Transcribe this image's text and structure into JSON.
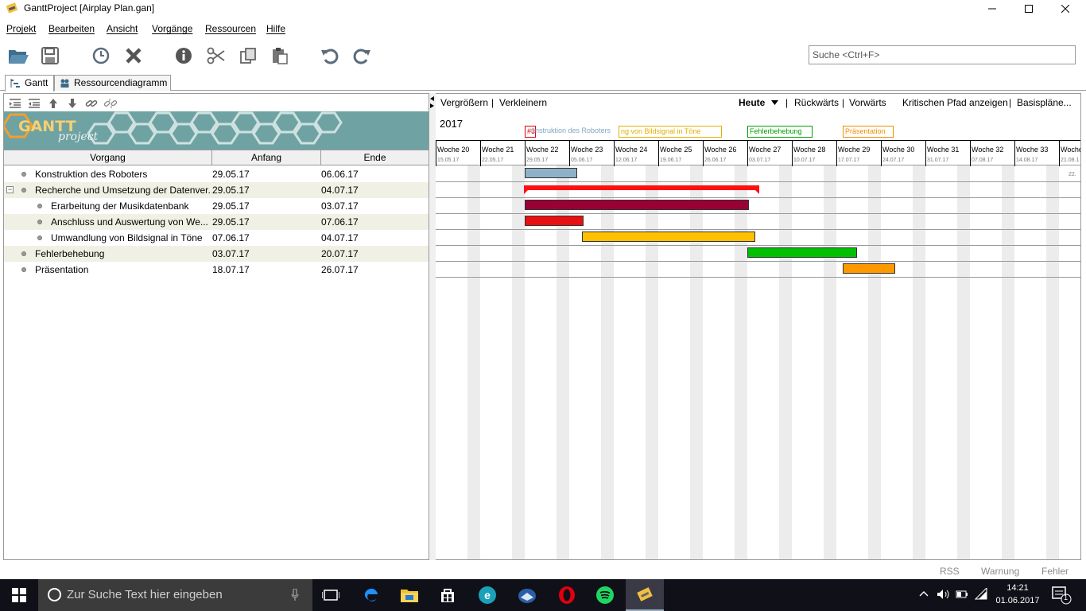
{
  "window": {
    "title": "GanttProject [Airplay Plan.gan]",
    "minimize_icon": "minimize-icon",
    "maximize_icon": "maximize-icon",
    "close_icon": "close-icon"
  },
  "menu": {
    "items": [
      "Projekt",
      "Bearbeiten",
      "Ansicht",
      "Vorgänge",
      "Ressourcen",
      "Hilfe"
    ]
  },
  "toolbar": {
    "icons": [
      "open-folder-icon",
      "save-icon",
      "history-icon",
      "delete-icon",
      "info-icon",
      "cut-icon",
      "copy-icon",
      "paste-icon",
      "undo-icon",
      "redo-icon"
    ],
    "search_placeholder": "Suche <Ctrl+F>"
  },
  "tabs": [
    {
      "label": "Gantt",
      "icon": "gantt-icon",
      "active": true
    },
    {
      "label": "Ressourcendiagramm",
      "icon": "resources-icon",
      "active": false
    }
  ],
  "task_table": {
    "tool_icons": [
      "outdent-icon",
      "indent-icon",
      "move-up-icon",
      "move-down-icon",
      "link-icon",
      "unlink-icon"
    ],
    "logo_text_1": "GANTT",
    "logo_text_2": "project",
    "columns": [
      "Vorgang",
      "Anfang",
      "Ende"
    ],
    "rows": [
      {
        "name": "Konstruktion des Roboters",
        "start": "29.05.17",
        "end": "06.06.17",
        "level": 0,
        "collapse": ""
      },
      {
        "name": "Recherche und Umsetzung der Datenver...",
        "start": "29.05.17",
        "end": "04.07.17",
        "level": 0,
        "collapse": "−"
      },
      {
        "name": "Erarbeitung der Musikdatenbank",
        "start": "29.05.17",
        "end": "03.07.17",
        "level": 1,
        "collapse": ""
      },
      {
        "name": "Anschluss und Auswertung von We...",
        "start": "29.05.17",
        "end": "07.06.17",
        "level": 1,
        "collapse": ""
      },
      {
        "name": "Umwandlung von Bildsignal in Töne",
        "start": "07.06.17",
        "end": "04.07.17",
        "level": 1,
        "collapse": ""
      },
      {
        "name": "Fehlerbehebung",
        "start": "03.07.17",
        "end": "20.07.17",
        "level": 0,
        "collapse": ""
      },
      {
        "name": "Präsentation",
        "start": "18.07.17",
        "end": "26.07.17",
        "level": 0,
        "collapse": ""
      }
    ]
  },
  "chart": {
    "zoom_in": "Vergrößern",
    "separator": "|",
    "zoom_out": "Verkleinern",
    "today": "Heute",
    "back": "Rückwärts",
    "forward": "Vorwärts",
    "critical_path": "Kritischen Pfad anzeigen",
    "baselines": "Basispläne...",
    "year": "2017",
    "weeks": [
      {
        "label": "Woche 20",
        "date": "15.05.17"
      },
      {
        "label": "Woche 21",
        "date": "22.05.17"
      },
      {
        "label": "Woche 22",
        "date": "29.05.17"
      },
      {
        "label": "Woche 23",
        "date": "05.06.17"
      },
      {
        "label": "Woche 24",
        "date": "12.06.17"
      },
      {
        "label": "Woche 25",
        "date": "19.06.17"
      },
      {
        "label": "Woche 26",
        "date": "26.06.17"
      },
      {
        "label": "Woche 27",
        "date": "03.07.17"
      },
      {
        "label": "Woche 28",
        "date": "10.07.17"
      },
      {
        "label": "Woche 29",
        "date": "17.07.17"
      },
      {
        "label": "Woche 30",
        "date": "24.07.17"
      },
      {
        "label": "Woche 31",
        "date": "31.07.17"
      },
      {
        "label": "Woche 32",
        "date": "07.08.17"
      },
      {
        "label": "Woche 33",
        "date": "14.08.17"
      },
      {
        "label": "Woche",
        "date": "21.08.1"
      }
    ],
    "top_labels": [
      {
        "text": "#3",
        "color": "#dd0000"
      },
      {
        "text": "onstruktion des Roboters",
        "color": "#7fa7c0"
      },
      {
        "text": "ng von Bildsignal in Töne",
        "color": "#e0b000"
      },
      {
        "text": "Fehlerbehebung",
        "color": "#00a000"
      },
      {
        "text": "Präsentation",
        "color": "#f08c00"
      }
    ],
    "edge_label": "22.",
    "bars": [
      {
        "start": "29.05.17",
        "end": "06.06.17",
        "color": "#8fb1c8",
        "type": "task"
      },
      {
        "start": "29.05.17",
        "end": "04.07.17",
        "color": "#ff1010",
        "type": "summary"
      },
      {
        "start": "29.05.17",
        "end": "03.07.17",
        "color": "#990033",
        "type": "task"
      },
      {
        "start": "29.05.17",
        "end": "07.06.17",
        "color": "#e81010",
        "type": "task"
      },
      {
        "start": "07.06.17",
        "end": "04.07.17",
        "color": "#ffc000",
        "type": "task"
      },
      {
        "start": "03.07.17",
        "end": "20.07.17",
        "color": "#00c000",
        "type": "task"
      },
      {
        "start": "18.07.17",
        "end": "26.07.17",
        "color": "#ff9900",
        "type": "task"
      }
    ]
  },
  "status": {
    "rss": "RSS",
    "warning": "Warnung",
    "error": "Fehler"
  },
  "taskbar": {
    "search_placeholder": "Zur Suche Text hier eingeben",
    "apps": [
      "task-view-icon",
      "edge-icon",
      "file-explorer-icon",
      "store-icon",
      "ecosia-icon",
      "thunderbird-icon",
      "opera-icon",
      "spotify-icon",
      "ganttproject-icon"
    ],
    "time": "14:21",
    "date": "01.06.2017",
    "notifications": "1"
  }
}
